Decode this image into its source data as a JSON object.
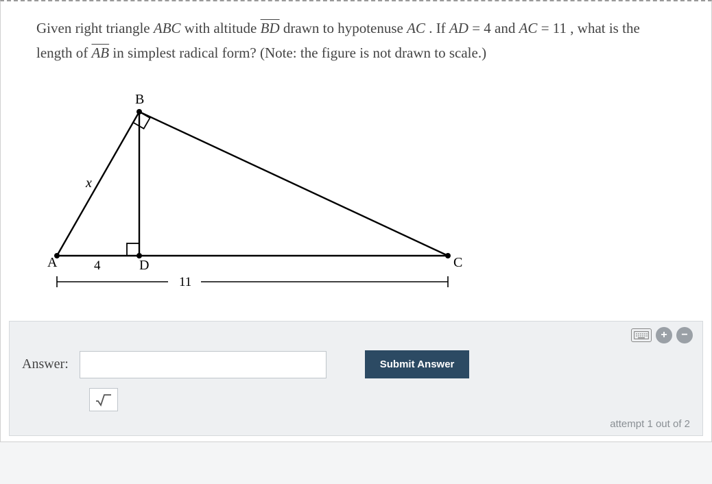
{
  "question": {
    "prefix": "Given right triangle ",
    "t1": "ABC",
    "t2": " with altitude ",
    "seg1": "BD",
    "t3": " drawn to hypotenuse ",
    "t4": "AC",
    "t5": ". If ",
    "eq1_lhs": "AD",
    "eq1_eq": " = ",
    "eq1_rhs": "4",
    "t6": " and ",
    "eq2_lhs": "AC",
    "eq2_eq": " = ",
    "eq2_rhs": "11",
    "t7": ", what is the length of ",
    "seg2": "AB",
    "t8": " in simplest radical form? (Note: the figure is not drawn to scale.)"
  },
  "figure": {
    "labels": {
      "A": "A",
      "B": "B",
      "C": "C",
      "D": "D",
      "x": "x",
      "ad": "4",
      "ac": "11"
    }
  },
  "answer_panel": {
    "label": "Answer:",
    "input_value": "",
    "submit": "Submit Answer",
    "sqrt_tooltip": "√",
    "attempt": "attempt 1 out of 2"
  },
  "tools": {
    "plus": "+",
    "minus": "−"
  }
}
